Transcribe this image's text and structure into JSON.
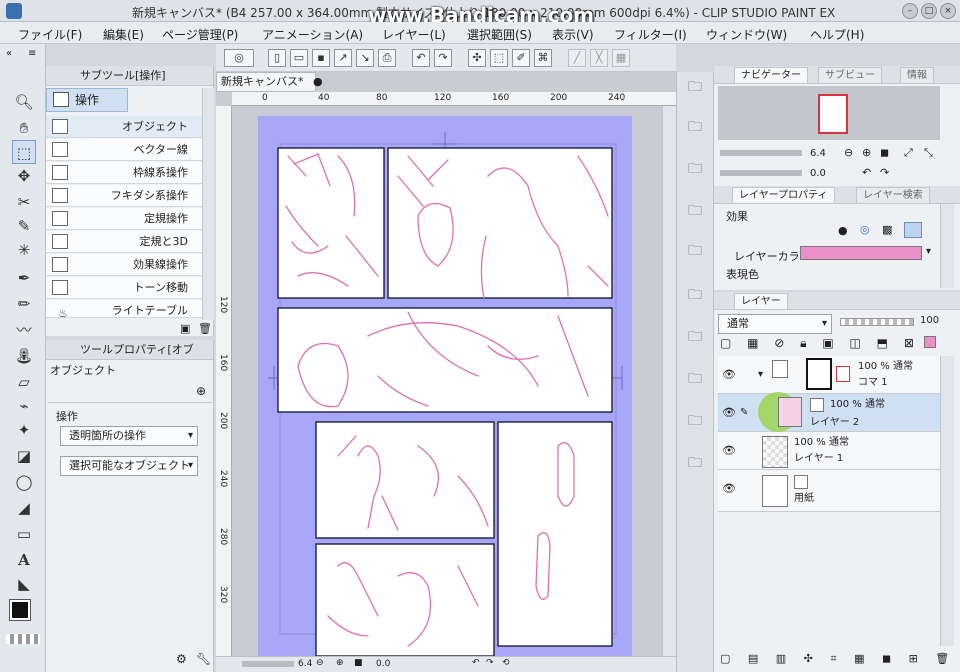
{
  "window": {
    "title": "新規キャンバス* (B4 257.00 x 364.00mm 製本サイズ: 仕上り 180.00 x 210.00mm 600dpi 6.4%) - CLIP STUDIO PAINT EX",
    "watermark": "www.Bandicam.com"
  },
  "menu": [
    "ファイル(F)",
    "編集(E)",
    "ページ管理(P)",
    "アニメーション(A)",
    "レイヤー(L)",
    "選択範囲(S)",
    "表示(V)",
    "フィルター(I)",
    "ウィンドウ(W)",
    "ヘルプ(H)"
  ],
  "subtool": {
    "header": "サブツール[操作]",
    "group_tab": "操作",
    "items": [
      "オブジェクト",
      "ベクター線",
      "枠線系操作",
      "フキダシ系操作",
      "定規操作",
      "定規と3D",
      "効果線操作",
      "トーン移動",
      "ライトテーブル"
    ]
  },
  "toolprop": {
    "header": "ツールプロパティ[オブ",
    "tool_name": "オブジェクト",
    "section": "操作",
    "dropdown1": "透明箇所の操作",
    "dropdown2": "選択可能なオブジェクト"
  },
  "canvas": {
    "doc_tab": "新規キャンバス*",
    "ruler_top": [
      "0",
      "40",
      "80",
      "120",
      "160",
      "200",
      "240"
    ],
    "ruler_left": [
      "120",
      "160",
      "200",
      "240",
      "280",
      "320"
    ],
    "zoom": "6.4",
    "angle": "0.0",
    "page_color": "#a8a6f7",
    "ink_color": "#e06fb0"
  },
  "navigator": {
    "tabs": [
      "ナビゲーター",
      "サブビュー",
      "情報"
    ],
    "zoom": "6.4",
    "angle": "0.0"
  },
  "layerprop": {
    "tabs": [
      "レイヤープロパティ",
      "レイヤー検索"
    ],
    "effect_label": "効果",
    "color_label": "レイヤーカラー",
    "express_label": "表現色",
    "layer_color": "#ea8fc7"
  },
  "layers": {
    "tab": "レイヤー",
    "blend": "通常",
    "opacity": "100",
    "rows": [
      {
        "line1": "100 % 通常",
        "line2": "コマ 1"
      },
      {
        "line1": "100 % 通常",
        "line2": "レイヤー 2"
      },
      {
        "line1": "100 % 通常",
        "line2": "レイヤー 1"
      },
      {
        "line1": "",
        "line2": "用紙"
      }
    ]
  }
}
